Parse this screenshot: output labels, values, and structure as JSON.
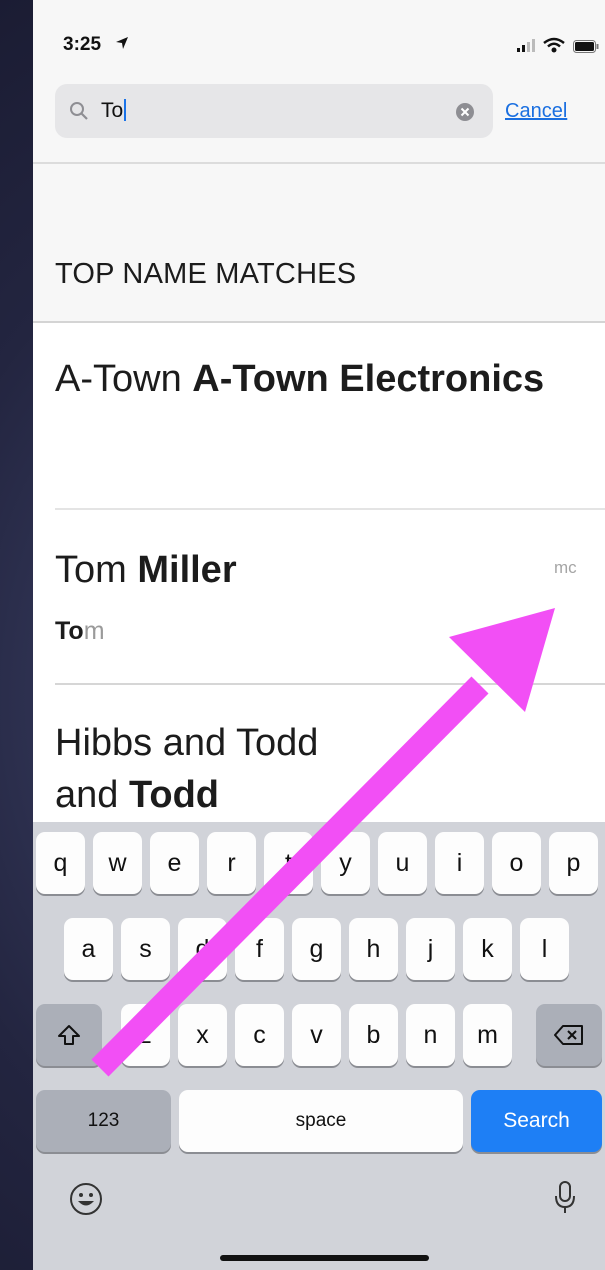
{
  "status_bar": {
    "time": "3:25",
    "icons": [
      "location-arrow-icon",
      "cellular-signal-icon",
      "wifi-icon",
      "battery-icon"
    ]
  },
  "search": {
    "value": "To",
    "cancel_label": "Cancel"
  },
  "section_header": "TOP NAME MATCHES",
  "results": [
    {
      "title_plain": "A-Town ",
      "title_bold": "A-Town Electronics"
    },
    {
      "title_plain": "Tom ",
      "title_bold": "Miller",
      "initials": "mc",
      "subtitle_match": "To",
      "subtitle_rest": "m"
    },
    {
      "title_plain": "Hibbs and Todd",
      "title_line2_plain": "and ",
      "title_line2_bold": "Todd"
    }
  ],
  "keyboard": {
    "row1": [
      "q",
      "w",
      "e",
      "r",
      "t",
      "y",
      "u",
      "i",
      "o",
      "p"
    ],
    "row2": [
      "a",
      "s",
      "d",
      "f",
      "g",
      "h",
      "j",
      "k",
      "l"
    ],
    "row3": [
      "z",
      "x",
      "c",
      "v",
      "b",
      "n",
      "m"
    ],
    "numbers_label": "123",
    "space_label": "space",
    "search_label": "Search",
    "icons": [
      "shift-icon",
      "backspace-icon",
      "emoji-icon",
      "microphone-icon"
    ]
  },
  "annotation": {
    "type": "arrow",
    "color": "#f24ff5"
  },
  "colors": {
    "accent": "#1a6fe0",
    "search_key": "#1e7ff5",
    "arrow": "#f24ff5"
  }
}
